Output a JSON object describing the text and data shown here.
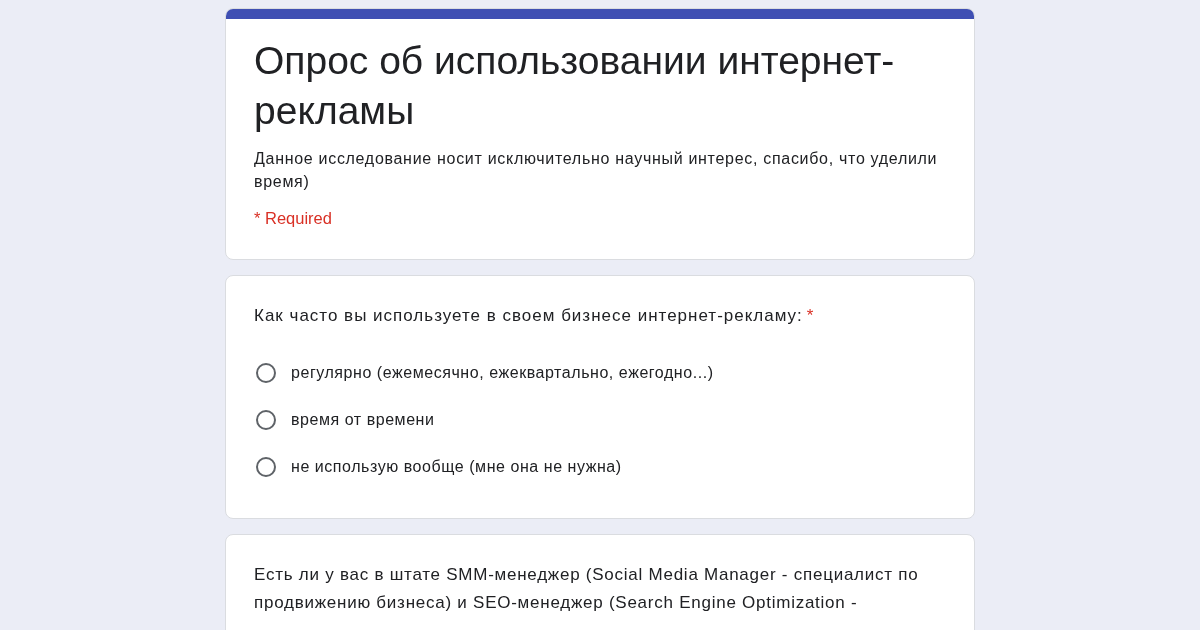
{
  "form": {
    "title": "Опрос об использовании интернет-рекламы",
    "description": "Данное исследование носит исключительно научный интерес, спасибо, что уделили время)",
    "required_note": "* Required"
  },
  "questions": [
    {
      "text": "Как часто вы используете в своем бизнесе интернет-рекламу:",
      "required_mark": "*",
      "options": [
        {
          "label": "регулярно (ежемесячно, ежеквартально, ежегодно...)",
          "selected": false
        },
        {
          "label": "время от времени",
          "selected": false
        },
        {
          "label": "не использую вообще (мне она не нужна)",
          "selected": false
        }
      ]
    },
    {
      "text": "Есть ли у вас в штате SMM-менеджер (Social Media Manager - специалист по продвижению бизнеса) и SEO-менеджер (Search Engine Optimization -"
    }
  ]
}
